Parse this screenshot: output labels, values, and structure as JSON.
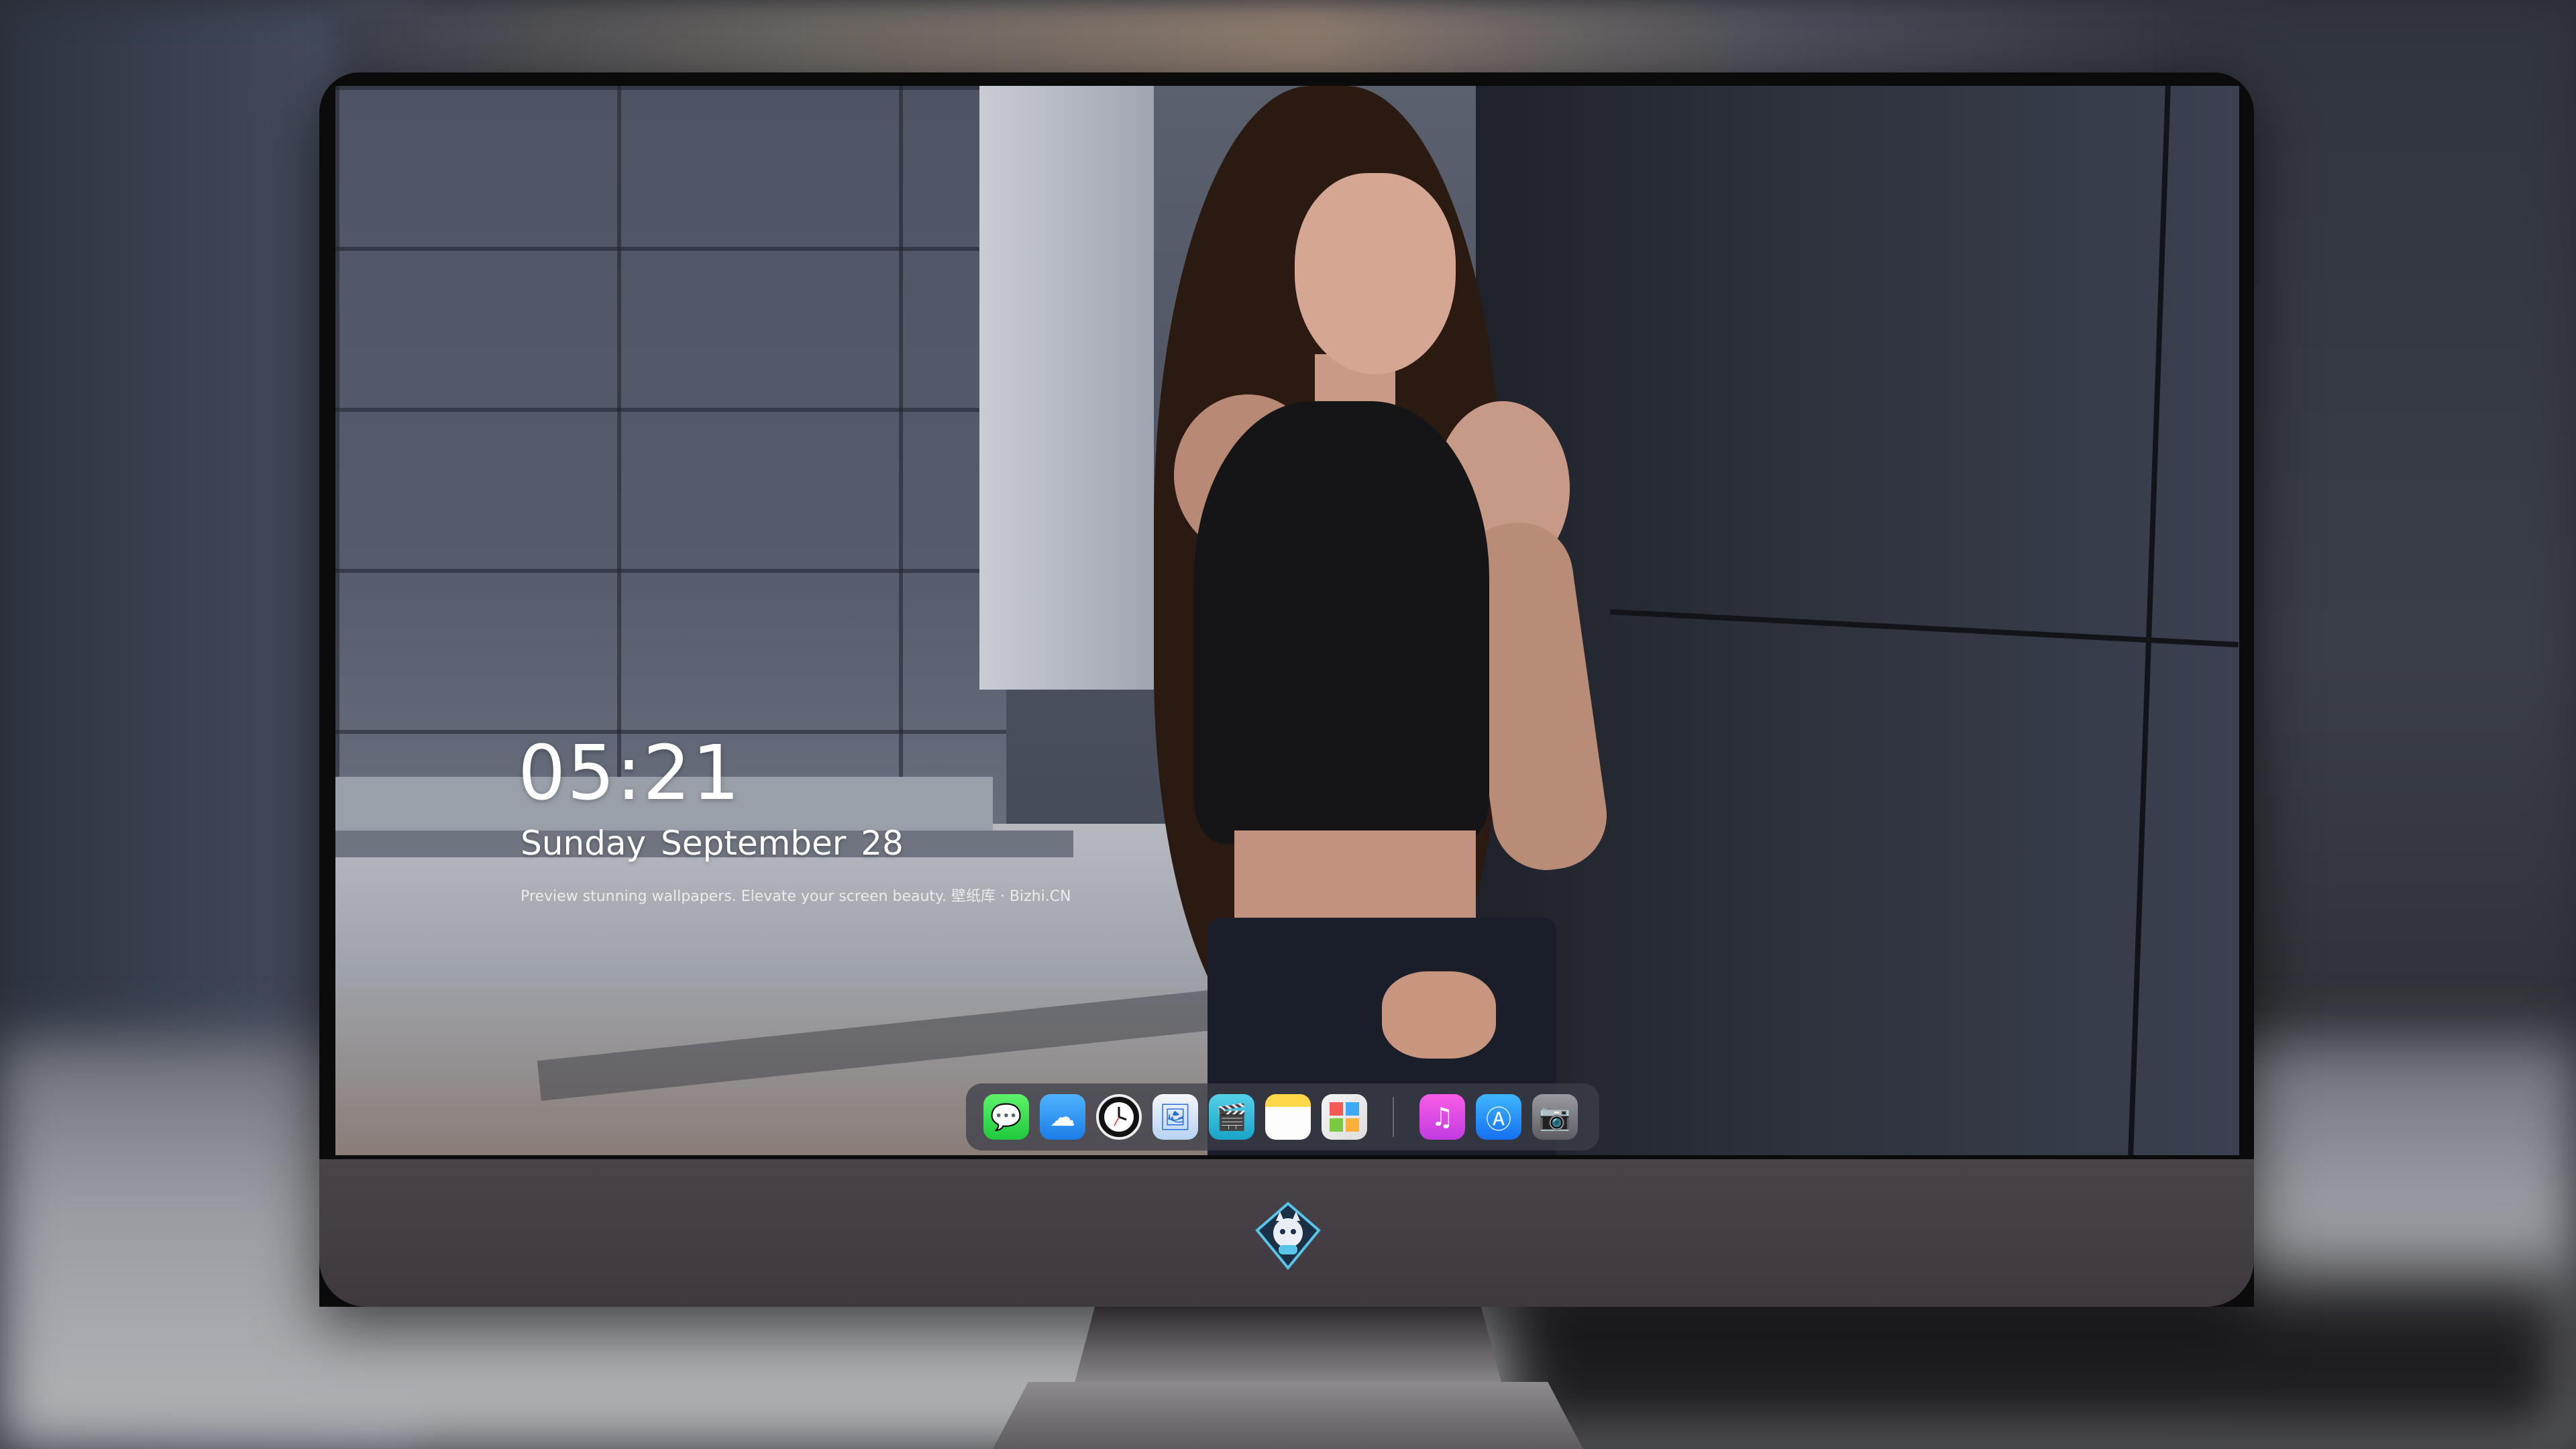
{
  "lockscreen": {
    "time": "05:21",
    "date": "Sunday September  28",
    "tagline": "Preview stunning wallpapers. Elevate your screen beauty. 壁纸库 · Bizhi.CN"
  },
  "dock": {
    "apps": [
      {
        "name": "messages-icon",
        "glyph": "💬"
      },
      {
        "name": "weather-icon",
        "glyph": "☁"
      },
      {
        "name": "clock-icon",
        "glyph": "🕘"
      },
      {
        "name": "preview-icon",
        "glyph": "🖼"
      },
      {
        "name": "clips-icon",
        "glyph": "🎬"
      },
      {
        "name": "notes-icon",
        "glyph": ""
      },
      {
        "name": "photos-icon",
        "glyph": "▦"
      },
      {
        "name": "music-icon",
        "glyph": "♫"
      },
      {
        "name": "app-store-icon",
        "glyph": "Ⓐ"
      },
      {
        "name": "camera-icon",
        "glyph": "📷"
      }
    ]
  },
  "colors": {
    "chin": "#4a4349",
    "bezel": "#0b0b0c",
    "dock_bg": "rgba(60,62,72,0.75)"
  }
}
